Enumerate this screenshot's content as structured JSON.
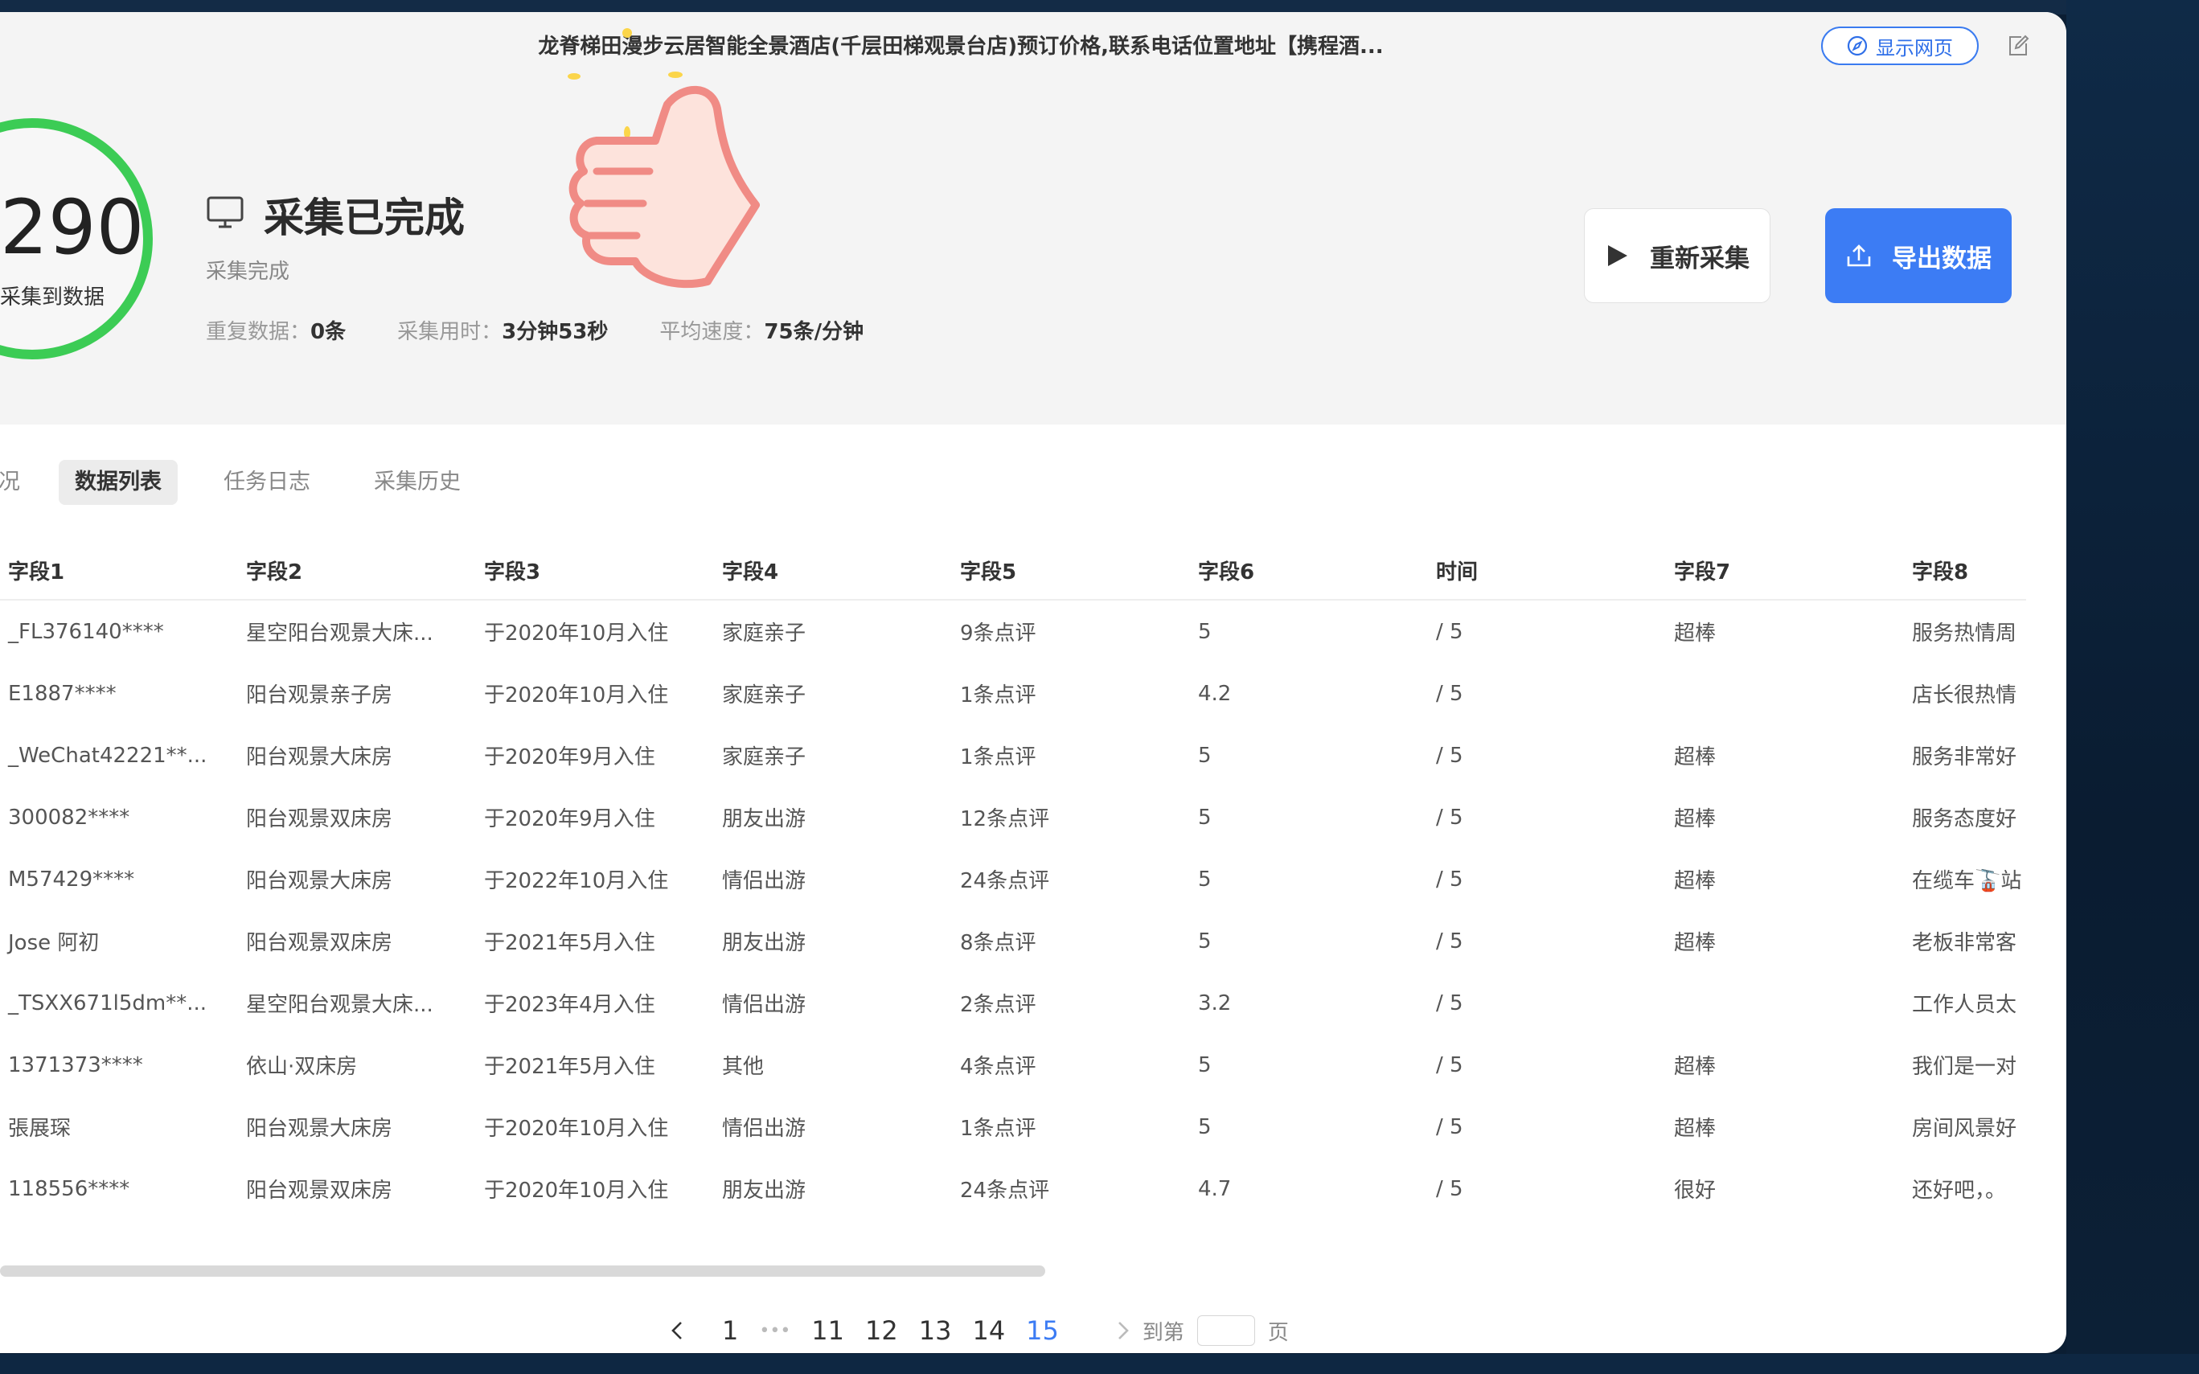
{
  "window": {
    "title": "龙脊梯田漫步云居智能全景酒店(千层田梯观景台店)预订价格,联系电话位置地址【携程酒...",
    "show_web_label": "显示网页"
  },
  "summary": {
    "count": "290",
    "count_label": "采集到数据",
    "status_title": "采集已完成",
    "status_sub": "采集完成",
    "stats": [
      {
        "label": "重复数据：",
        "value": "0条"
      },
      {
        "label": "采集用时：",
        "value": "3分钟53秒"
      },
      {
        "label": "平均速度：",
        "value": "75条/分钟"
      }
    ],
    "restart_label": "重新采集",
    "export_label": "导出数据"
  },
  "tabs": [
    {
      "label": "况"
    },
    {
      "label": "数据列表"
    },
    {
      "label": "任务日志"
    },
    {
      "label": "采集历史"
    }
  ],
  "table": {
    "columns": [
      "字段1",
      "字段2",
      "字段3",
      "字段4",
      "字段5",
      "字段6",
      "时间",
      "字段7",
      "字段8"
    ],
    "rows": [
      [
        "_FL376140****",
        "星空阳台观景大床...",
        "于2020年10月入住",
        "家庭亲子",
        "9条点评",
        "5",
        "/ 5",
        "超棒",
        "服务热情周"
      ],
      [
        "E1887****",
        "阳台观景亲子房",
        "于2020年10月入住",
        "家庭亲子",
        "1条点评",
        "4.2",
        "/ 5",
        "",
        "店长很热情"
      ],
      [
        "_WeChat42221**...",
        "阳台观景大床房",
        "于2020年9月入住",
        "家庭亲子",
        "1条点评",
        "5",
        "/ 5",
        "超棒",
        "服务非常好"
      ],
      [
        "300082****",
        "阳台观景双床房",
        "于2020年9月入住",
        "朋友出游",
        "12条点评",
        "5",
        "/ 5",
        "超棒",
        "服务态度好"
      ],
      [
        "M57429****",
        "阳台观景大床房",
        "于2022年10月入住",
        "情侣出游",
        "24条点评",
        "5",
        "/ 5",
        "超棒",
        "在缆车🚡站"
      ],
      [
        "Jose 阿初",
        "阳台观景双床房",
        "于2021年5月入住",
        "朋友出游",
        "8条点评",
        "5",
        "/ 5",
        "超棒",
        "老板非常客"
      ],
      [
        "_TSXX671l5dm**...",
        "星空阳台观景大床...",
        "于2023年4月入住",
        "情侣出游",
        "2条点评",
        "3.2",
        "/ 5",
        "",
        "工作人员太"
      ],
      [
        "1371373****",
        "依山·双床房",
        "于2021年5月入住",
        "其他",
        "4条点评",
        "5",
        "/ 5",
        "超棒",
        "我们是一对"
      ],
      [
        "張展琛",
        "阳台观景大床房",
        "于2020年10月入住",
        "情侣出游",
        "1条点评",
        "5",
        "/ 5",
        "超棒",
        "房间风景好"
      ],
      [
        "118556****",
        "阳台观景双床房",
        "于2020年10月入住",
        "朋友出游",
        "24条点评",
        "4.7",
        "/ 5",
        "很好",
        "还好吧，。"
      ]
    ]
  },
  "pagination": {
    "pages": [
      "1",
      "•••",
      "11",
      "12",
      "13",
      "14",
      "15"
    ],
    "current": "15",
    "goto_label": "到第",
    "page_unit": "页"
  },
  "colors": {
    "accent": "#3c7cf4",
    "ring": "#3ccc55"
  }
}
